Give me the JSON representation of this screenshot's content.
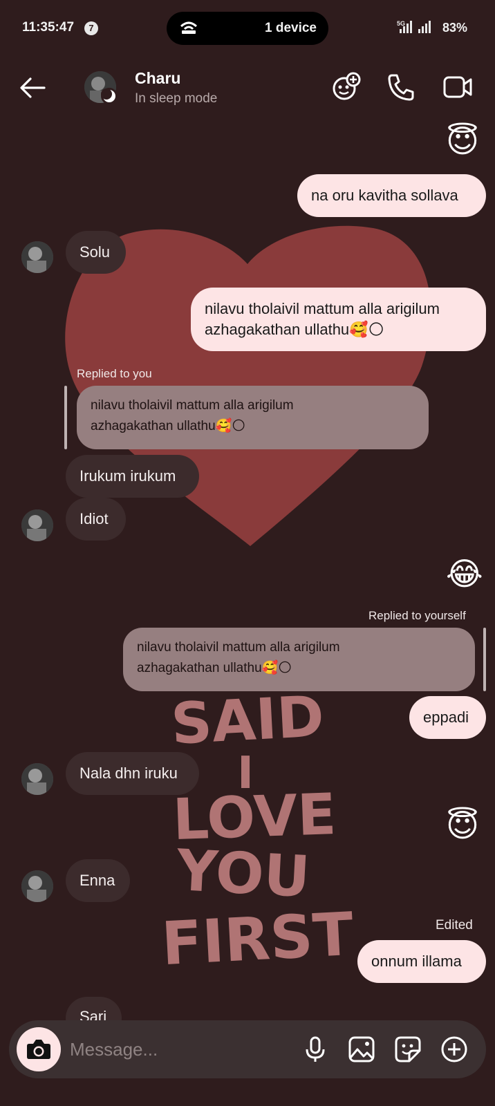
{
  "status_bar": {
    "time": "11:35:47",
    "notification_count": "7",
    "device_pill": "1 device",
    "network": "5G",
    "battery": "83%"
  },
  "header": {
    "name": "Charu",
    "status": "In sleep mode",
    "icons": [
      "back-arrow-icon",
      "effects-icon",
      "phone-icon",
      "video-icon"
    ]
  },
  "messages": {
    "m1_emoji": "😇",
    "m2": "na oru kavitha sollava",
    "m3": "Solu",
    "m4": "nilavu tholaivil mattum alla arigilum\nazhagakathan ullathu🥰🌕",
    "m5_reply_label": "Replied to you",
    "m5_quote": "nilavu tholaivil mattum alla arigilum\nazhagakathan ullathu🥰🌕",
    "m5": "Irukum irukum",
    "m6": "Idiot",
    "m7_emoji": "😂",
    "m8_reply_label": "Replied to yourself",
    "m8_quote": "nilavu tholaivil mattum alla arigilum\nazhagakathan ullathu🥰🌕",
    "m8": "eppadi",
    "m9": "Nala dhn iruku",
    "m10_emoji": "😇",
    "m11": "Enna",
    "m12_label": "Edited",
    "m12": "onnum illama",
    "m13": "Sari"
  },
  "background_text": [
    "SAID",
    "I",
    "LOVE",
    "YOU",
    "FIRST"
  ],
  "composer": {
    "placeholder": "Message..."
  },
  "colors": {
    "background": "#2f1c1d",
    "heart": "#8a3b3b",
    "outgoing_bubble": "#fde4e5",
    "incoming_bubble": "#3c2b2c",
    "reply_bubble": "#967f80",
    "wallpaper_text": "#b07474"
  }
}
